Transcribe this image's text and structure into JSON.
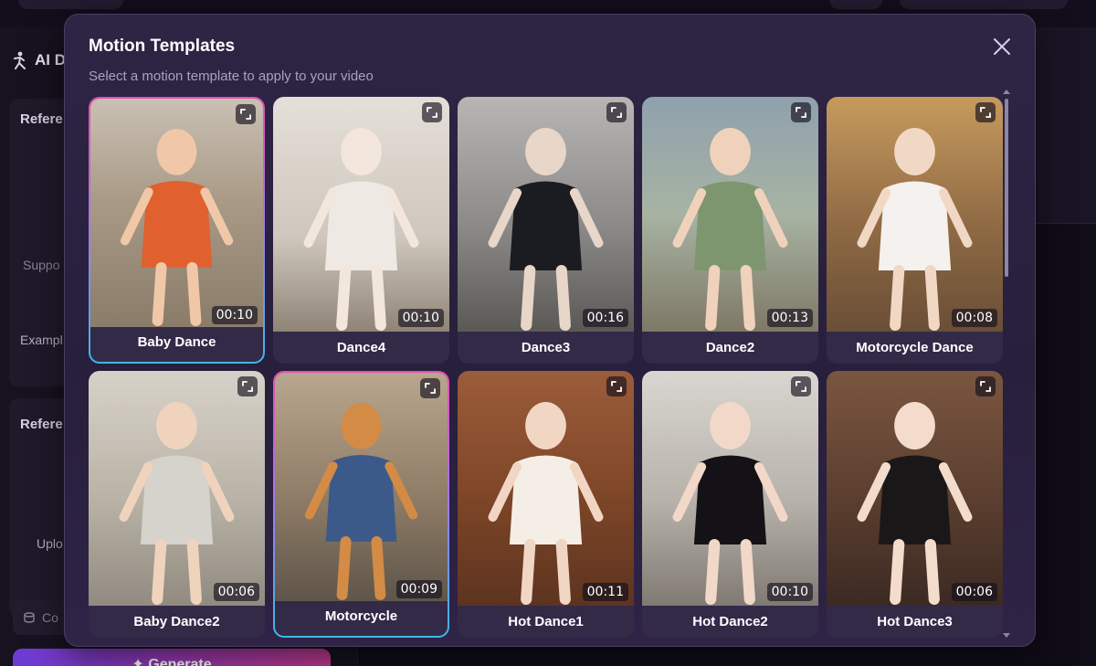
{
  "background": {
    "panel_title": "AI D",
    "card1_label": "Refere",
    "card1_hint": "Suppo",
    "examples_label": "Exampl",
    "card2_label": "Refere",
    "upload_hint": "Uplo",
    "credits_label": "Co",
    "generate_label": "✦ Generate"
  },
  "modal": {
    "title": "Motion Templates",
    "subtitle": "Select a motion template to apply to your video",
    "close_icon": "close-icon"
  },
  "templates": [
    {
      "label": "Baby Dance",
      "duration": "00:10",
      "selected": true
    },
    {
      "label": "Dance4",
      "duration": "00:10",
      "selected": false
    },
    {
      "label": "Dance3",
      "duration": "00:16",
      "selected": false
    },
    {
      "label": "Dance2",
      "duration": "00:13",
      "selected": false
    },
    {
      "label": "Motorcycle Dance",
      "duration": "00:08",
      "selected": false
    },
    {
      "label": "Baby Dance2",
      "duration": "00:06",
      "selected": false
    },
    {
      "label": "Motorcycle",
      "duration": "00:09",
      "selected": true
    },
    {
      "label": "Hot Dance1",
      "duration": "00:11",
      "selected": false
    },
    {
      "label": "Hot Dance2",
      "duration": "00:10",
      "selected": false
    },
    {
      "label": "Hot Dance3",
      "duration": "00:06",
      "selected": false
    }
  ],
  "colors": {
    "accent_pink": "#e84eb3",
    "accent_blue": "#3bb8e8",
    "modal_bg": "#2e2545"
  }
}
